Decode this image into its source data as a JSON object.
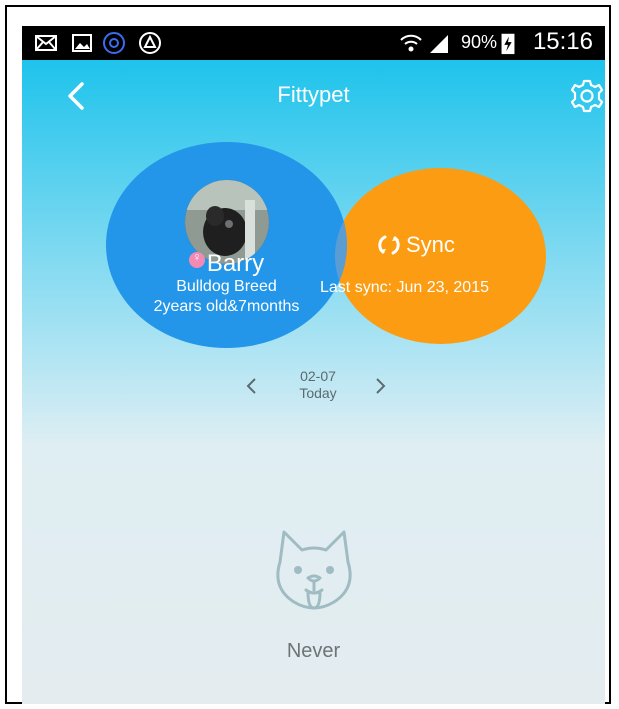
{
  "status_bar": {
    "battery_percent": "90%",
    "time": "15:16",
    "icons": [
      "mail-icon",
      "gallery-icon",
      "app-icon-a",
      "app-icon-camera",
      "wifi-icon",
      "signal-icon",
      "battery-charging-icon"
    ]
  },
  "app_bar": {
    "title": "Fittypet",
    "back_icon": "chevron-left-icon",
    "settings_icon": "gear-icon"
  },
  "pet": {
    "name": "Barry",
    "gender_icon": "female-icon",
    "breed": "Bulldog Breed",
    "age": "2years old&7months"
  },
  "sync": {
    "label": "Sync",
    "icon": "sync-icon",
    "last_sync": "Last sync: Jun 23, 2015"
  },
  "date_nav": {
    "date": "02-07",
    "day": "Today"
  },
  "empty_state": {
    "icon": "dog-face-icon",
    "label": "Never"
  },
  "colors": {
    "header_top": "#1ec3ec",
    "pet_circle": "#2396e9",
    "sync_circle": "#fb9c12",
    "background": "#e4ecef"
  }
}
